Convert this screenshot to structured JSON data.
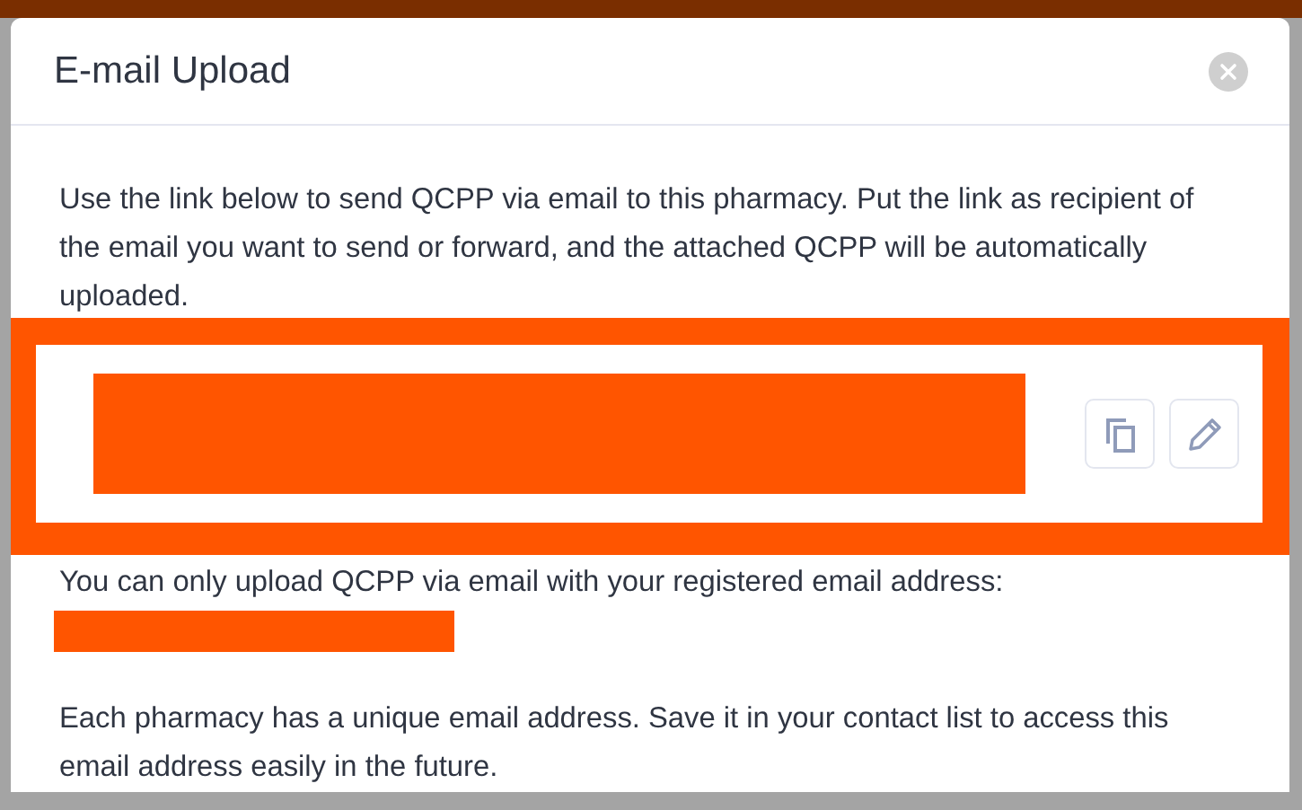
{
  "modal": {
    "title": "E-mail Upload",
    "intro": "Use the link below to send QCPP via email to this pharmacy. Put the link as recipient of the email you want to send or forward, and the attached QCPP will be automatically uploaded.",
    "link_actions": [
      {
        "kind": "copy"
      },
      {
        "kind": "edit"
      }
    ],
    "registered_note": "You can only upload QCPP via email with your registered email address:",
    "footer_note": "Each pharmacy has a unique email address. Save it in your contact list to access this email address easily in the future."
  }
}
